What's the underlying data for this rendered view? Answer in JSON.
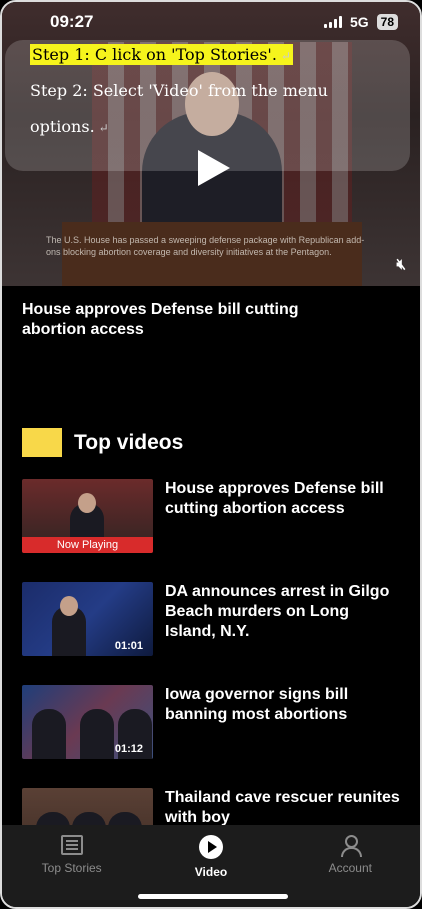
{
  "status_bar": {
    "time": "09:27",
    "network": "5G",
    "battery": "78"
  },
  "instructions": {
    "step1": "Step 1: C lick on 'Top Stories'.",
    "step2": "Step 2: Select 'Video' from the menu",
    "step2_cont": "options.",
    "mark": "↵"
  },
  "hero": {
    "caption": "The U.S. House has passed a sweeping defense package with Republican add-ons blocking abortion coverage and diversity initiatives at the Pentagon.",
    "headline": "House approves Defense bill cutting abortion access"
  },
  "section": {
    "title": "Top videos",
    "accent_color": "#f8d849"
  },
  "videos": [
    {
      "title": "House approves Defense bill cutting abortion access",
      "badge": "Now Playing",
      "duration": ""
    },
    {
      "title": "DA announces arrest in Gilgo Beach murders on Long Island, N.Y.",
      "badge": "",
      "duration": "01:01"
    },
    {
      "title": "Iowa governor signs bill banning most abortions",
      "badge": "",
      "duration": "01:12"
    },
    {
      "title": "Thailand cave rescuer reunites with boy",
      "badge": "",
      "duration": ""
    }
  ],
  "nav": {
    "items": [
      {
        "label": "Top Stories",
        "icon": "newspaper-icon"
      },
      {
        "label": "Video",
        "icon": "play-circle-icon"
      },
      {
        "label": "Account",
        "icon": "account-icon"
      }
    ],
    "active": "Video"
  }
}
